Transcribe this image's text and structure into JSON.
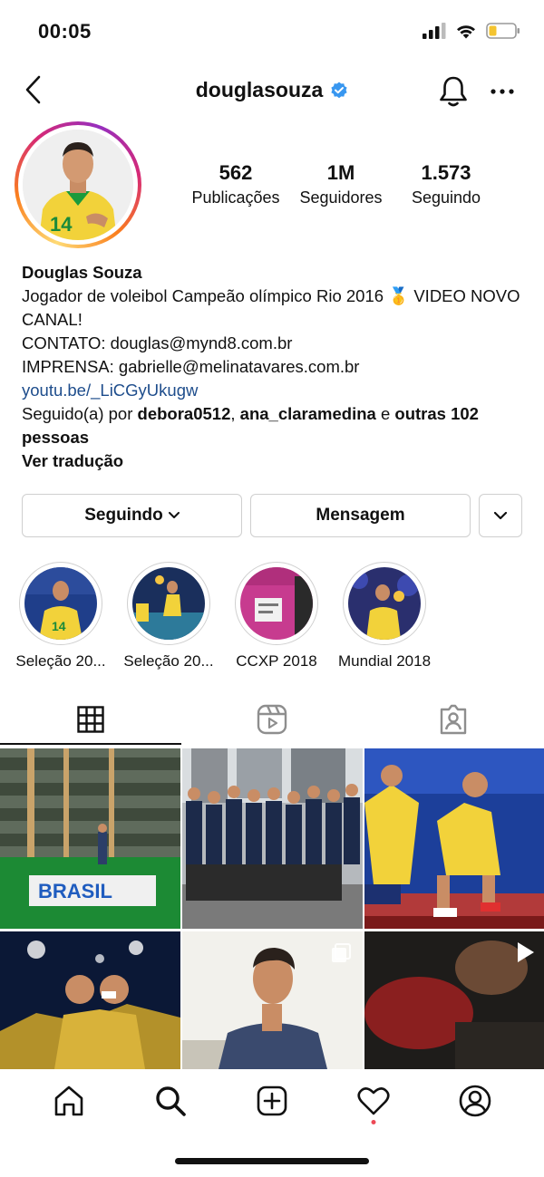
{
  "status_bar": {
    "time": "00:05"
  },
  "header": {
    "username": "douglasouza"
  },
  "stats": [
    {
      "value": "562",
      "label": "Publicações"
    },
    {
      "value": "1M",
      "label": "Seguidores"
    },
    {
      "value": "1.573",
      "label": "Seguindo"
    }
  ],
  "bio": {
    "name": "Douglas Souza",
    "line1": "Jogador de voleibol Campeão olímpico Rio 2016 🥇 VIDEO NOVO CANAL!",
    "line2": "CONTATO: douglas@mynd8.com.br",
    "line3": "IMPRENSA: gabrielle@melinatavares.com.br",
    "link": "youtu.be/_LiCGyUkugw",
    "followed_prefix": "Seguido(a) por ",
    "followed_user1": "debora0512",
    "followed_sep": ", ",
    "followed_user2": "ana_claramedina",
    "followed_and": " e ",
    "followed_rest": "outras 102 pessoas",
    "translate": "Ver tradução"
  },
  "actions": {
    "following": "Seguindo",
    "message": "Mensagem"
  },
  "highlights": [
    {
      "label": "Seleção 20..."
    },
    {
      "label": "Seleção 20..."
    },
    {
      "label": "CCXP 2018"
    },
    {
      "label": "Mundial 2018"
    }
  ],
  "posts": {
    "brasil_sign_text": "BRASIL"
  },
  "colors": {
    "link": "#1e4d8c",
    "notification_dot": "#ed4956",
    "verified": "#3897f0"
  }
}
